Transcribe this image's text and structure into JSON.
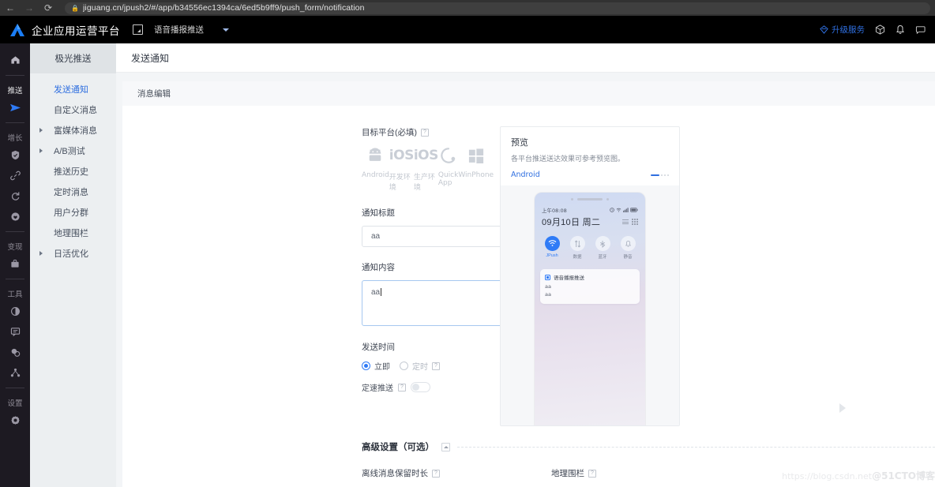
{
  "browser": {
    "back_icon": "back-arrow-icon",
    "forward_icon": "forward-arrow-icon",
    "reload_icon": "reload-icon",
    "lock_icon": "lock-icon",
    "url": "jiguang.cn/jpush2/#/app/b34556ec1394ca/6ed5b9ff9/push_form/notification"
  },
  "topbar": {
    "brand": "企业应用运营平台",
    "app_switch_icon": "app-switch-icon",
    "app_name": "语音播报推送",
    "caret_icon": "chevron-down-icon",
    "upgrade_label": "升级服务",
    "upgrade_icon": "diamond-icon",
    "help_icon": "cube-help-icon",
    "bell_icon": "bell-icon",
    "chat_icon": "chat-bubble-icon",
    "accent": "#2f6fe0"
  },
  "rail": {
    "home_icon": "home-icon",
    "groups": [
      {
        "label": "推送",
        "active": true,
        "icons": [
          "send-plane-icon"
        ]
      },
      {
        "label": "增长",
        "active": false,
        "icons": [
          "shield-check-icon",
          "link-icon",
          "refresh-icon",
          "heart-globe-icon"
        ]
      },
      {
        "label": "变现",
        "active": false,
        "icons": [
          "briefcase-icon"
        ]
      },
      {
        "label": "工具",
        "active": false,
        "icons": [
          "contrast-icon",
          "message-icon",
          "bubbles-icon",
          "share-nodes-icon"
        ]
      },
      {
        "label": "设置",
        "active": false,
        "icons": [
          "gear-icon"
        ]
      }
    ]
  },
  "sidebar": {
    "header": "极光推送",
    "items": [
      {
        "label": "发送通知",
        "active": true,
        "expandable": false
      },
      {
        "label": "自定义消息",
        "active": false,
        "expandable": false
      },
      {
        "label": "富媒体消息",
        "active": false,
        "expandable": true
      },
      {
        "label": "A/B测试",
        "active": false,
        "expandable": true
      },
      {
        "label": "推送历史",
        "active": false,
        "expandable": false
      },
      {
        "label": "定时消息",
        "active": false,
        "expandable": false
      },
      {
        "label": "用户分群",
        "active": false,
        "expandable": false
      },
      {
        "label": "地理围栏",
        "active": false,
        "expandable": false
      },
      {
        "label": "日活优化",
        "active": false,
        "expandable": true
      }
    ]
  },
  "page": {
    "title": "发送通知",
    "card_header": "消息编辑"
  },
  "form": {
    "platform_label": "目标平台(必填)",
    "platforms": [
      {
        "name": "Android",
        "icon": "android-icon"
      },
      {
        "name": "开发环境",
        "icon": "ios-icon"
      },
      {
        "name": "生产环境",
        "icon": "ios-icon"
      },
      {
        "name": "Quick App",
        "icon": "quickapp-icon"
      },
      {
        "name": "WinPhone",
        "icon": "windows-icon"
      }
    ],
    "title_label": "通知标题",
    "title_value": "aa",
    "content_label": "通知内容",
    "content_value": "aa",
    "send_time_label": "发送时间",
    "radio_now": "立即",
    "radio_scheduled": "定时",
    "rate_label": "定速推送",
    "rate_enabled": false
  },
  "preview": {
    "title": "预览",
    "subtitle": "各平台推送送达效果可参考预览图。",
    "tab": "Android",
    "next_icon": "chevron-right-icon",
    "phone": {
      "status_time": "上午08:08",
      "status_icons": "alarm-wifi-signal-battery",
      "date": "09月10日  周二",
      "toggles": [
        {
          "name": "JPush",
          "icon": "wifi-icon",
          "on": true
        },
        {
          "name": "数据",
          "icon": "data-icon",
          "on": false
        },
        {
          "name": "蓝牙",
          "icon": "bluetooth-icon",
          "on": false
        },
        {
          "name": "静音",
          "icon": "bell-mute-icon",
          "on": false
        }
      ],
      "notification": {
        "app": "语音播报推送",
        "title_line": "aa",
        "body_line": "aa"
      }
    }
  },
  "advanced": {
    "title": "高级设置（可选）",
    "collapse_icon": "chevron-up-icon",
    "fields": [
      {
        "label": "离线消息保留时长"
      },
      {
        "label": "地理围栏"
      }
    ]
  },
  "watermark": {
    "url": "https://blog.csdn.net",
    "tag": "@51CTO博客"
  }
}
